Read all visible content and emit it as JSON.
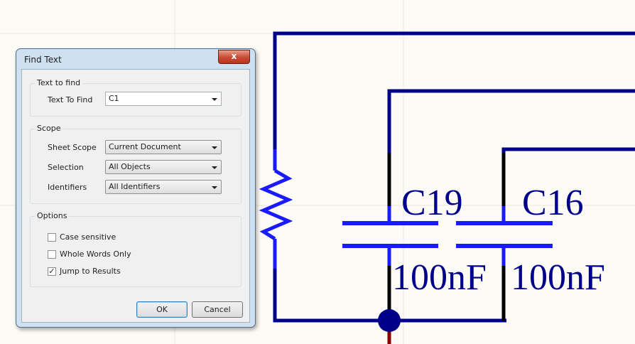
{
  "schematic": {
    "designators": [
      "C19",
      "C16"
    ],
    "values": [
      "100nF",
      "100nF"
    ]
  },
  "dialog": {
    "title": "Find Text",
    "close_glyph": "x",
    "text_group": {
      "title": "Text to find",
      "text_to_find_label": "Text To Find",
      "text_to_find_value": "C1"
    },
    "scope_group": {
      "title": "Scope",
      "sheet_scope_label": "Sheet Scope",
      "sheet_scope_value": "Current Document",
      "selection_label": "Selection",
      "selection_value": "All Objects",
      "identifiers_label": "Identifiers",
      "identifiers_value": "All Identifiers"
    },
    "options_group": {
      "title": "Options",
      "case_sensitive_label": "Case sensitive",
      "case_sensitive_checked": false,
      "whole_words_label": "Whole Words Only",
      "whole_words_checked": false,
      "jump_label": "Jump to Results",
      "jump_checked": true,
      "check_glyph": "✓"
    },
    "ok_label": "OK",
    "cancel_label": "Cancel"
  },
  "colors": {
    "wire": "#00008b",
    "pin": "#000000",
    "highlight": "#1a1aff",
    "net": "#8b0000",
    "grid": "#ece8dc"
  }
}
